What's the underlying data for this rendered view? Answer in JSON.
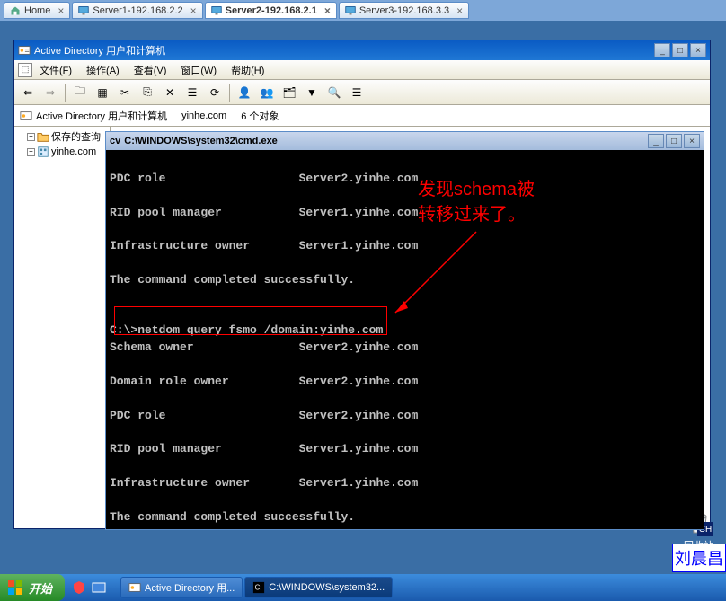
{
  "top_tabs": {
    "home": "Home",
    "server1": "Server1-192.168.2.2",
    "server2": "Server2-192.168.2.1",
    "server3": "Server3-192.168.3.3"
  },
  "aduc": {
    "title": "Active Directory 用户和计算机",
    "tree_root": "Active Directory 用户和计算机",
    "tree_saved": "保存的查询",
    "tree_domain": "yinhe.com",
    "info_domain": "yinhe.com",
    "info_objects": "6 个对象",
    "menu": {
      "file": "文件(F)",
      "action": "操作(A)",
      "view": "查看(V)",
      "window": "窗口(W)",
      "help": "帮助(H)"
    }
  },
  "cmd": {
    "title": "C:\\WINDOWS\\system32\\cmd.exe",
    "title_prefix": "cv",
    "output": "\nPDC role                   Server2.yinhe.com\n\nRID pool manager           Server1.yinhe.com\n\nInfrastructure owner       Server1.yinhe.com\n\nThe command completed successfully.\n\n\nC:\\>netdom query fsmo /domain:yinhe.com\nSchema owner               Server2.yinhe.com\n\nDomain role owner          Server2.yinhe.com\n\nPDC role                   Server2.yinhe.com\n\nRID pool manager           Server1.yinhe.com\n\nInfrastructure owner       Server1.yinhe.com\n\nThe command completed successfully.\n\n\nC:\\>_"
  },
  "annotation": {
    "line1": "发现schema被",
    "line2": "转移过来了。"
  },
  "desktop": {
    "recycle": "回收站"
  },
  "corner": "刘晨昌",
  "lang": "CH",
  "taskbar": {
    "start": "开始",
    "task1": "Active Directory 用...",
    "task2": "C:\\WINDOWS\\system32..."
  }
}
